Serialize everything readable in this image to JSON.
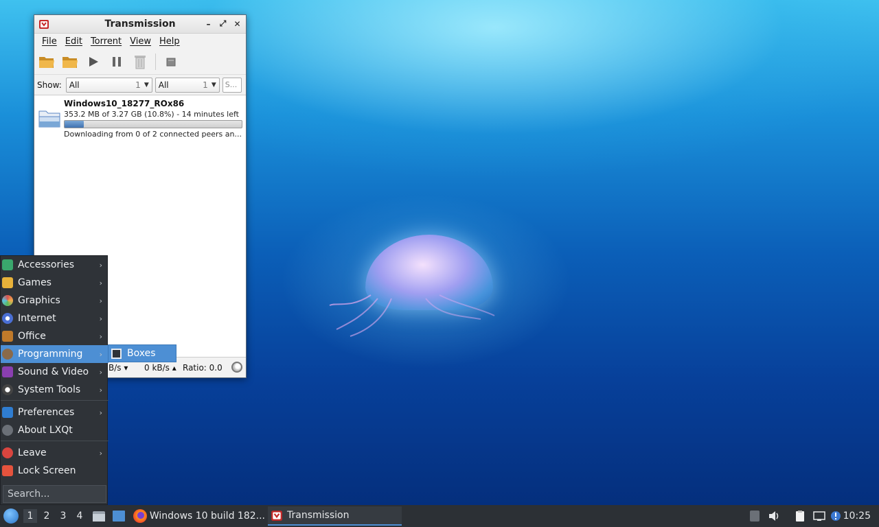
{
  "window": {
    "title": "Transmission",
    "controls": {
      "minimize": "–",
      "maximize": "⤢",
      "close": "✕"
    },
    "menu": [
      "File",
      "Edit",
      "Torrent",
      "View",
      "Help"
    ],
    "filter": {
      "label": "Show:",
      "combo1": {
        "value": "All",
        "count": "1"
      },
      "combo2": {
        "value": "All",
        "count": "1"
      },
      "search_placeholder": "S..."
    },
    "torrent": {
      "name": "Windows10_18277_ROx86",
      "size_text": "353.2 MB of 3.27 GB (10.8%) - 14 minutes left",
      "progress": 0.108,
      "status_text": "Downloading from 0 of 2 connected peers an..."
    },
    "statusbar": {
      "down": "B/s ▾",
      "up": "0 kB/s ▴",
      "ratio": "Ratio: 0.0"
    }
  },
  "start_menu": {
    "items": [
      {
        "label": "Accessories",
        "icon": "accessories-icon",
        "color": "#3aa76d"
      },
      {
        "label": "Games",
        "icon": "games-icon",
        "color": "#e8b23a"
      },
      {
        "label": "Graphics",
        "icon": "graphics-icon",
        "color": "#d9534f"
      },
      {
        "label": "Internet",
        "icon": "internet-icon",
        "color": "#4a6fd4"
      },
      {
        "label": "Office",
        "icon": "office-icon",
        "color": "#c07a2a"
      },
      {
        "label": "Programming",
        "icon": "programming-icon",
        "color": "#8a6a4a"
      },
      {
        "label": "Sound & Video",
        "icon": "sound-video-icon",
        "color": "#8a3fb0"
      },
      {
        "label": "System Tools",
        "icon": "system-tools-icon",
        "color": "#cfd3d7"
      }
    ],
    "preferences": "Preferences",
    "about": "About LXQt",
    "leave": "Leave",
    "lock": "Lock Screen",
    "search_placeholder": "Search...",
    "submenu_item": "Boxes"
  },
  "taskbar": {
    "workspaces": [
      "1",
      "2",
      "3",
      "4"
    ],
    "tasks": [
      {
        "label": "Windows 10 build 182..."
      },
      {
        "label": "Transmission"
      }
    ],
    "clock": "10:25"
  },
  "colors": {
    "accent": "#4d8fd4",
    "panel": "#2c3035",
    "menu_bg": "#2f3338"
  }
}
